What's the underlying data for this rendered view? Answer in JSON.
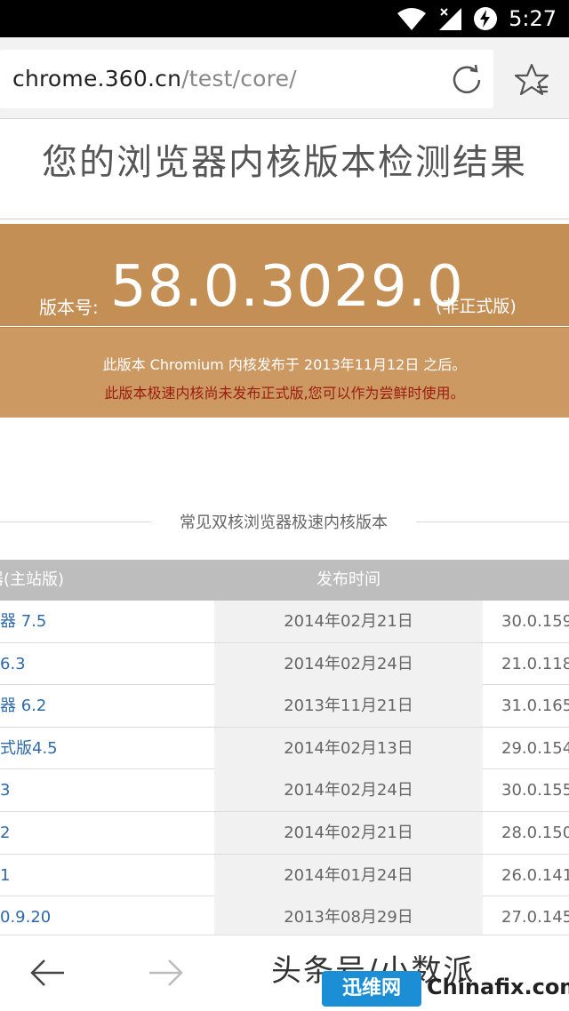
{
  "status_bar": {
    "time": "5:27"
  },
  "browser": {
    "url_host": "chrome.360.cn",
    "url_path": "/test/core/"
  },
  "page": {
    "title": "您的浏览器内核版本检测结果",
    "version_label": "版本号:",
    "version_number": "58.0.3029.0",
    "version_tag": "(非正式版)",
    "info_line1": "此版本 Chromium 内核发布于 2013年11月12日 之后。",
    "info_line2": "此版本极速内核尚未发布正式版,您可以作为尝鲜时使用。",
    "section_title": "常见双核浏览器极速内核版本"
  },
  "table": {
    "headers": [
      "器(主站版)",
      "发布时间",
      ""
    ],
    "rows": [
      {
        "name": "器 7.5",
        "date": "2014年02月21日",
        "core": "30.0.159"
      },
      {
        "name": "6.3",
        "date": "2014年02月24日",
        "core": "21.0.118"
      },
      {
        "name": "器 6.2",
        "date": "2013年11月21日",
        "core": "31.0.165"
      },
      {
        "name": "式版4.5",
        "date": "2014年02月13日",
        "core": "29.0.154"
      },
      {
        "name": "3",
        "date": "2014年02月24日",
        "core": "30.0.155"
      },
      {
        "name": "2",
        "date": "2014年02月21日",
        "core": "28.0.150"
      },
      {
        "name": "1",
        "date": "2014年01月24日",
        "core": "26.0.141"
      },
      {
        "name": "0.9.20",
        "date": "2013年08月29日",
        "core": "27.0.145"
      }
    ]
  },
  "bottom_bar": {
    "watermark": "头条号/小数派",
    "badge_text": "迅维网",
    "badge_site": "Chinafix.com"
  },
  "colors": {
    "banner": "#c48f55",
    "info_panel": "#cd9963",
    "warning_text": "#9b1c0e",
    "link": "#2f6aa8",
    "table_header": "#bdbdbd"
  },
  "icons": [
    "wifi-icon",
    "signal-icon",
    "battery-charging-icon",
    "reload-icon",
    "star-bookmark-icon",
    "back-arrow-icon",
    "forward-arrow-icon"
  ]
}
